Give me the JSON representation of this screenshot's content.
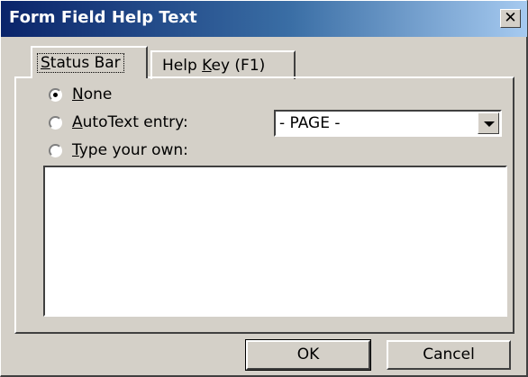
{
  "window": {
    "title": "Form Field Help Text",
    "close_glyph": "✕"
  },
  "tabs": [
    {
      "label_pre": "",
      "label_ul": "S",
      "label_post": "tatus Bar",
      "active": true
    },
    {
      "label_pre": "Help ",
      "label_ul": "K",
      "label_post": "ey (F1)",
      "active": false
    }
  ],
  "options": [
    {
      "label_pre": "",
      "label_ul": "N",
      "label_post": "one",
      "selected": true
    },
    {
      "label_pre": "",
      "label_ul": "A",
      "label_post": "utoText entry:",
      "selected": false
    },
    {
      "label_pre": "",
      "label_ul": "T",
      "label_post": "ype your own:",
      "selected": false
    }
  ],
  "autotext_select": {
    "value": "- PAGE -",
    "icon": "chevron-down-icon"
  },
  "help_text": {
    "value": ""
  },
  "buttons": {
    "ok": "OK",
    "cancel": "Cancel"
  },
  "colors": {
    "dialog_bg": "#d4d0c8",
    "title_gradient_start": "#0a246a",
    "title_gradient_end": "#a6caf0"
  }
}
